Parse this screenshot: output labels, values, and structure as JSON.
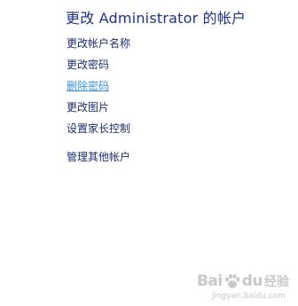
{
  "page": {
    "title": "更改 Administrator 的帐户"
  },
  "tasks": [
    {
      "label": "更改帐户名称"
    },
    {
      "label": "更改密码"
    },
    {
      "label": "删除密码"
    },
    {
      "label": "更改图片"
    },
    {
      "label": "设置家长控制"
    },
    {
      "label": "管理其他帐户"
    }
  ],
  "watermark": {
    "brand": "Bai",
    "brand_suffix": "du",
    "product": "经验",
    "url": "jingyan.baidu.com"
  }
}
